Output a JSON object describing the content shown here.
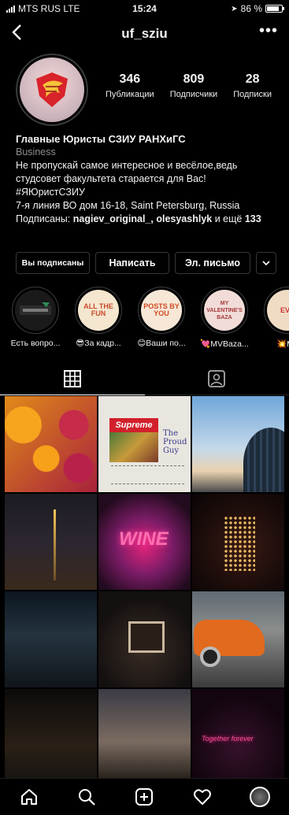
{
  "status_bar": {
    "carrier": "MTS RUS LTE",
    "time": "15:24",
    "battery": "86 %",
    "battery_level": 0.86
  },
  "header": {
    "username": "uf_sziu",
    "back_icon": "chevron-left-icon",
    "more_icon": "ellipsis-icon"
  },
  "profile": {
    "stats": [
      {
        "value": "346",
        "label": "Публикации"
      },
      {
        "value": "809",
        "label": "Подписчики"
      },
      {
        "value": "28",
        "label": "Подписки"
      }
    ],
    "name": "Главные Юристы СЗИУ РАНХиГС",
    "category": "Business",
    "bio_line1": "Не пропускай самое интересное и весёлое,ведь студсовет факультета старается для Вас!",
    "hashtag": "#ЯЮристСЗИУ",
    "address": "7-я линия ВО дом 16-18, Saint Petersburg, Russia",
    "followed_prefix": "Подписаны: ",
    "followed_names": "nagiev_original_, olesyashlyk",
    "followed_mid": " и ещё ",
    "followed_count": "133"
  },
  "actions": {
    "following": "Вы подписаны",
    "message": "Написать",
    "email": "Эл. письмо",
    "more_icon": "chevron-down-icon"
  },
  "highlights": [
    {
      "label": "Есть вопро...",
      "cover": "",
      "emoji": ""
    },
    {
      "label": "😎За кадр...",
      "cover": "ALL THE FUN"
    },
    {
      "label": "😊Ваши по...",
      "cover": "POSTS BY YOU"
    },
    {
      "label": "💘MVBaza...",
      "cover": "MY VALENTINE'S BAZA"
    },
    {
      "label": "💥Ме",
      "cover": "EVE"
    }
  ],
  "tabs": [
    {
      "name": "grid",
      "icon": "grid-icon"
    },
    {
      "name": "tagged",
      "icon": "tagged-person-icon"
    }
  ],
  "posts": [
    {
      "alt": "Citrus fruits",
      "text": ""
    },
    {
      "alt": "Supreme card",
      "text": "Supreme",
      "text2": "The Proud Guy"
    },
    {
      "alt": "Dome and sky",
      "text": ""
    },
    {
      "alt": "Night spire",
      "text": ""
    },
    {
      "alt": "Neon WINE sign",
      "text": "WINE"
    },
    {
      "alt": "Light deer",
      "text": ""
    },
    {
      "alt": "Bar interior",
      "text": ""
    },
    {
      "alt": "Framed picture",
      "text": ""
    },
    {
      "alt": "Orange car",
      "text": ""
    },
    {
      "alt": "Dark restaurant",
      "text": ""
    },
    {
      "alt": "City sunset",
      "text": ""
    },
    {
      "alt": "Neon sign",
      "text": "Together forever"
    }
  ],
  "bottom_nav": [
    {
      "name": "home",
      "icon": "home-icon"
    },
    {
      "name": "search",
      "icon": "search-icon"
    },
    {
      "name": "new-post",
      "icon": "plus-square-icon"
    },
    {
      "name": "activity",
      "icon": "heart-icon"
    },
    {
      "name": "profile",
      "icon": "profile-avatar-icon"
    }
  ],
  "colors": {
    "background": "#000000",
    "text": "#f2f2f2",
    "muted": "#8e8e8e",
    "border": "#363636"
  }
}
